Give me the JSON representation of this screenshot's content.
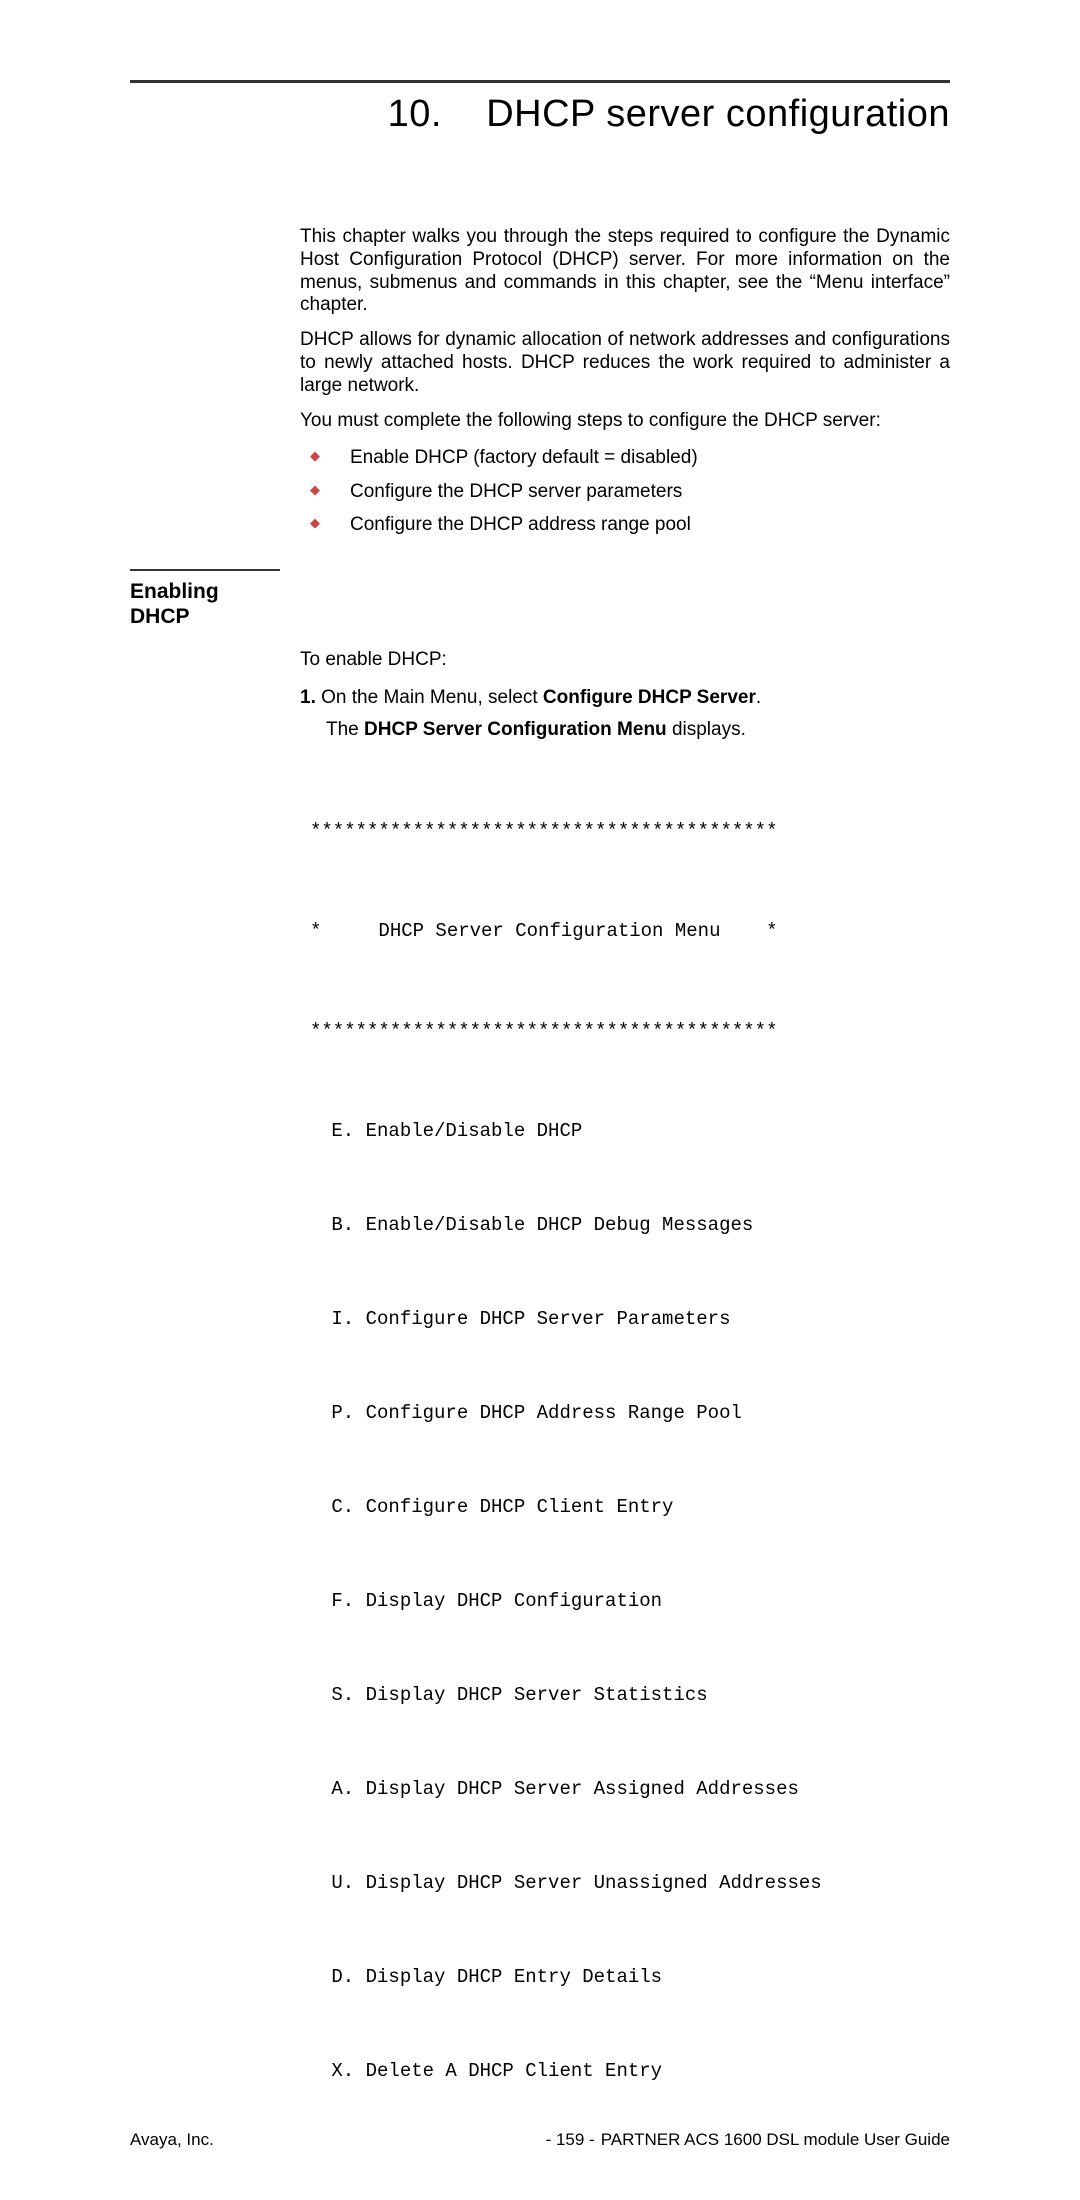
{
  "chapter": {
    "number": "10.",
    "title": "DHCP server configuration"
  },
  "intro": {
    "p1": "This chapter walks you through the steps required to configure the Dynamic Host Configuration Protocol (DHCP) server.  For more information on the menus, submenus and commands in this chapter, see the “Menu interface” chapter.",
    "p2": "DHCP allows for dynamic allocation of network addresses and configurations to newly attached hosts.  DHCP reduces the work required to administer a large network.",
    "p3": "You must complete the following steps to configure the DHCP server:",
    "bullets": [
      "Enable DHCP (factory default = disabled)",
      "Configure the DHCP server parameters",
      "Configure the DHCP address range pool"
    ]
  },
  "section": {
    "heading_line1": "Enabling",
    "heading_line2": "DHCP",
    "lead": "To enable DHCP:",
    "step1_num": "1.",
    "step1_pre": "On the Main Menu, select ",
    "step1_bold": "Configure DHCP Server",
    "step1_post": ".",
    "step1_sub_pre": "The ",
    "step1_sub_bold": "DHCP Server Configuration Menu",
    "step1_sub_post": " displays."
  },
  "menu": {
    "border": "*****************************************",
    "title": "*     DHCP Server Configuration Menu    *",
    "items": [
      " E. Enable/Disable DHCP",
      " B. Enable/Disable DHCP Debug Messages",
      " I. Configure DHCP Server Parameters",
      " P. Configure DHCP Address Range Pool",
      " C. Configure DHCP Client Entry",
      " F. Display DHCP Configuration",
      " S. Display DHCP Server Statistics",
      " A. Display DHCP Server Assigned Addresses",
      " U. Display DHCP Server Unassigned Addresses",
      " D. Display DHCP Entry Details",
      " X. Delete A DHCP Client Entry"
    ]
  },
  "footer": {
    "left": "Avaya, Inc.",
    "page": "- 159 -",
    "right": "PARTNER ACS 1600 DSL module User Guide"
  }
}
